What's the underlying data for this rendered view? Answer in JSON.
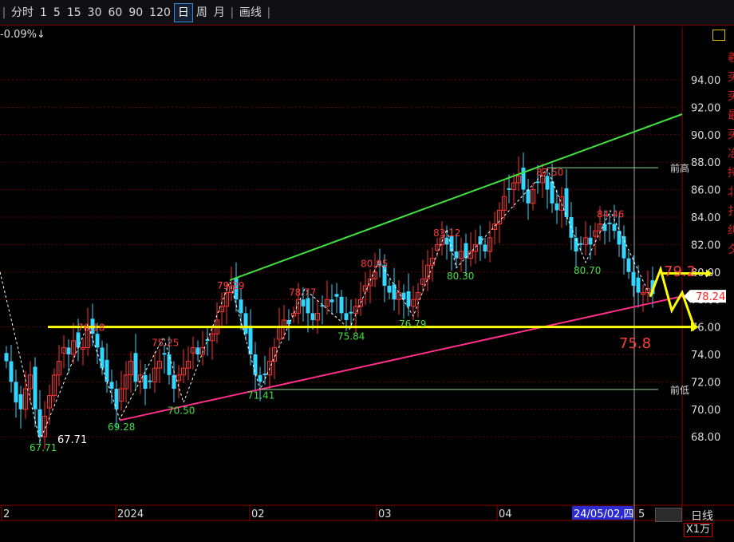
{
  "toolbar": {
    "items": [
      "分时",
      "1",
      "5",
      "15",
      "30",
      "60",
      "90",
      "120",
      "日",
      "周",
      "月",
      "画线"
    ],
    "active": "日"
  },
  "header": {
    "pct_text": "-0.09%↓",
    "side_chars": [
      "羲",
      "买",
      "买",
      "最",
      "买",
      "冶",
      "持",
      "北",
      "扌",
      "纠",
      "夕"
    ]
  },
  "axis": {
    "y_ticks": [
      "94.00",
      "92.00",
      "90.00",
      "88.00",
      "86.00",
      "84.00",
      "82.00",
      "80.00",
      "78.00",
      "76.00",
      "74.00",
      "72.00",
      "70.00",
      "68.00"
    ],
    "x_ticks": [
      "2",
      "2024",
      "02",
      "03",
      "04",
      "5"
    ],
    "cursor_date": "24/05/02,四",
    "day_line": "日线",
    "unit": "X1万"
  },
  "colors": {
    "up": "#ff3030",
    "down": "#33d6ff",
    "green_line": "#40e040",
    "pink_line": "#ff2e8a",
    "yellow_line": "#ffff00",
    "grid": "#6a0000"
  },
  "chart_data": {
    "type": "candlestick",
    "ylim": [
      66.5,
      96.5
    ],
    "annotations": {
      "highs": [
        [
          "76.18",
          "High"
        ],
        [
          "75.25",
          "High"
        ],
        [
          "79.29",
          "High"
        ],
        [
          "78.77",
          "High"
        ],
        [
          "80.85",
          "High"
        ],
        [
          "83.12",
          "High"
        ],
        [
          "87.50",
          "High"
        ],
        [
          "84.46",
          "High"
        ]
      ],
      "lows": [
        [
          "67.71",
          "Low"
        ],
        [
          "69.28",
          "Low"
        ],
        [
          "70.50",
          "Low"
        ],
        [
          "71.41",
          "Low"
        ],
        [
          "75.84",
          "Low"
        ],
        [
          "76.79",
          "Low"
        ],
        [
          "80.30",
          "Low"
        ],
        [
          "80.70",
          "Low"
        ]
      ],
      "current_price": "78.24",
      "targets": [
        "79.2",
        "75.8"
      ],
      "prev_high": "前高",
      "prev_low": "前低",
      "low_white": "67.71"
    },
    "lines": {
      "channel_top": [
        [
          69.28,
          "start"
        ],
        [
          91.5,
          "end"
        ]
      ],
      "support": 76.0
    }
  }
}
